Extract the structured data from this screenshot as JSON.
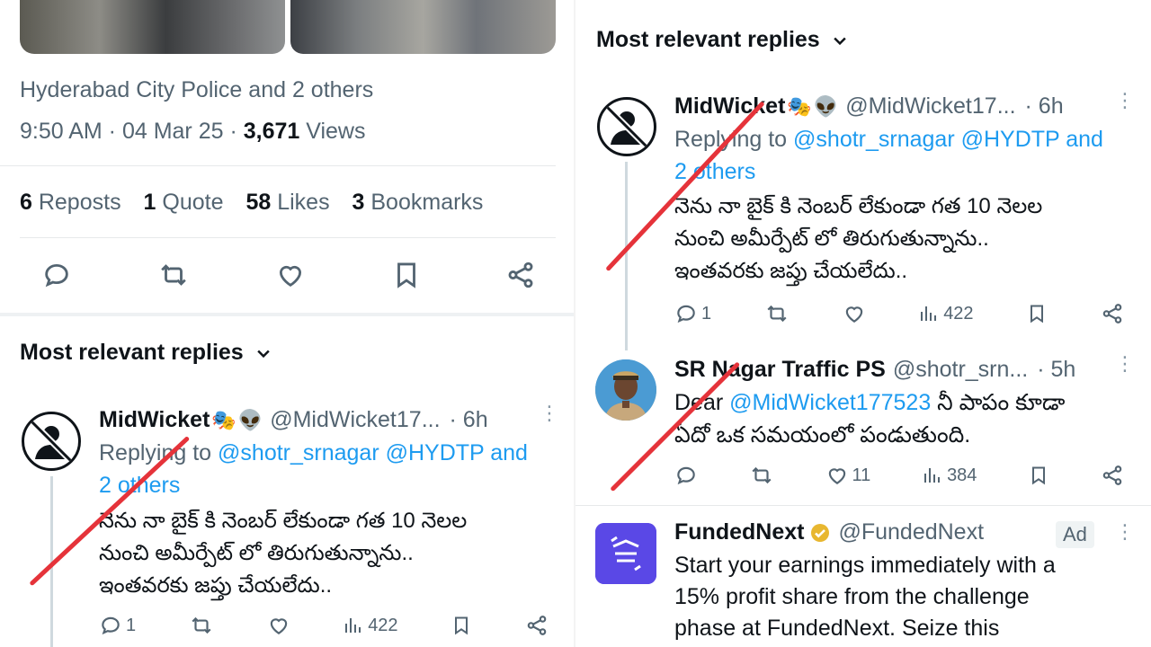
{
  "left": {
    "tagged": "Hyderabad City Police and 2 others",
    "time": "9:50 AM · 04 Mar 25 · ",
    "views_count": "3,671",
    "views_label": " Views",
    "stats": [
      {
        "count": "6",
        "label": " Reposts"
      },
      {
        "count": "1",
        "label": " Quote"
      },
      {
        "count": "58",
        "label": " Likes"
      },
      {
        "count": "3",
        "label": " Bookmarks"
      }
    ],
    "section_title": "Most relevant replies",
    "reply1": {
      "name": "MidWicket",
      "handle": "@MidWicket17...",
      "time": "· 6h",
      "replying_prefix": "Replying to ",
      "replying_targets": "@shotr_srnagar @HYDTP and",
      "replying_more": "2 others",
      "text_line1": "నెను నా బైక్ కి నెంబర్ లేకుండా గత 10 నెలల",
      "text_line2": "నుంచి అమీర్పేట్ లో  తిరుగుతున్నాను..",
      "text_line3": "ఇంతవరకు జప్తు చేయలేదు..",
      "replies": "1",
      "views": "422"
    }
  },
  "right": {
    "section_title": "Most relevant replies",
    "reply1": {
      "name": "MidWicket",
      "handle": "@MidWicket17...",
      "time": "· 6h",
      "replying_prefix": "Replying to ",
      "replying_targets": "@shotr_srnagar @HYDTP and",
      "replying_more": "2 others",
      "text_line1": "నెను నా బైక్ కి నెంబర్ లేకుండా గత 10 నెలల",
      "text_line2": "నుంచి అమీర్పేట్ లో  తిరుగుతున్నాను..",
      "text_line3": "ఇంతవరకు జప్తు చేయలేదు..",
      "replies": "1",
      "views": "422"
    },
    "reply2": {
      "name": "SR Nagar Traffic PS",
      "handle": "@shotr_srn...",
      "time": "· 5h",
      "text_prefix": "Dear ",
      "mention": "@MidWicket177523",
      "text_line1_rest": " నీ పాపం కూడా",
      "text_line2": "ఏదో ఒక సమయంలో పండుతుంది.",
      "likes": "11",
      "views": "384"
    },
    "ad": {
      "name": "FundedNext",
      "handle": "@FundedNext",
      "badge": "Ad",
      "text_line1": "Start your earnings immediately with a",
      "text_line2": "15% profit share from the challenge",
      "text_line3": "phase at FundedNext. Seize this"
    }
  },
  "colors": {
    "accent": "#1d9bf0",
    "strike": "#e5333a",
    "muted": "#536471"
  }
}
